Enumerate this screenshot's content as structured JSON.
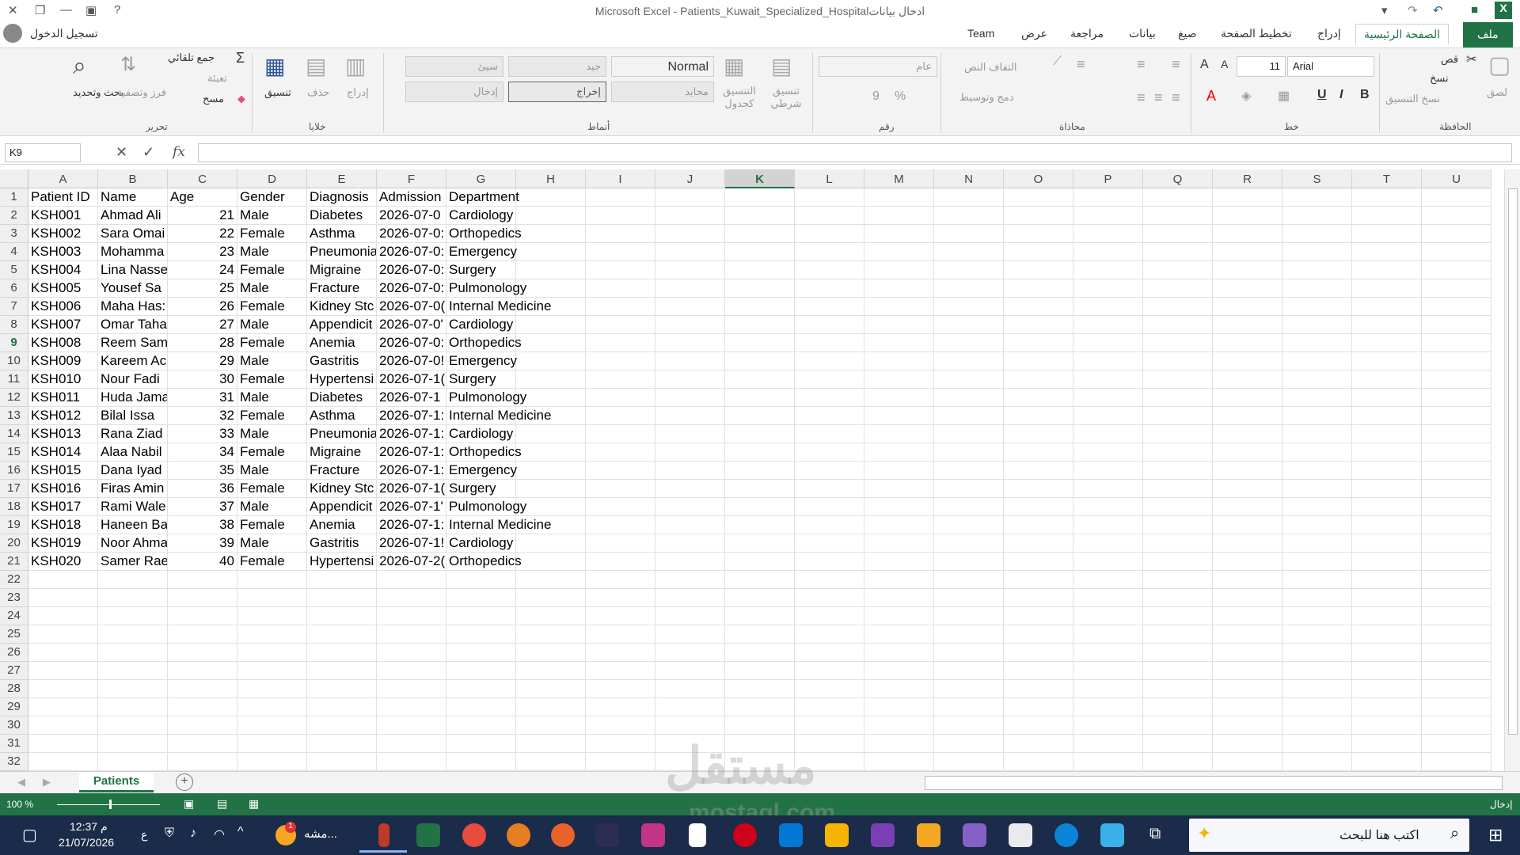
{
  "window": {
    "title": "Microsoft Excel - Patients_Kuwait_Specialized_Hospitalادخال بيانات",
    "signin": "تسجيل الدخول"
  },
  "tabs": {
    "file": "ملف",
    "home": "الصفحة الرئيسية",
    "insert": "إدراج",
    "layout": "تخطيط الصفحة",
    "formulas": "صيغ",
    "data": "بيانات",
    "review": "مراجعة",
    "view": "عرض",
    "team": "Team"
  },
  "ribbon": {
    "clipboard": {
      "label": "الحافظة",
      "paste": "لصق",
      "cut": "قص",
      "copy": "نسخ",
      "format_painter": "نسخ التنسيق"
    },
    "font": {
      "label": "خط",
      "name": "Arial",
      "size": "11",
      "bold": "B",
      "italic": "I",
      "underline": "U"
    },
    "alignment": {
      "label": "محاذاة",
      "wrap": "التفاف النص",
      "merge": "دمج وتوسيط"
    },
    "number": {
      "label": "رقم",
      "format": "عام",
      "percent": "%",
      "comma": "9"
    },
    "styles": {
      "label": "أنماط",
      "conditional": "تنسيق شرطي",
      "as_table": "التنسيق كجدول",
      "normal": "Normal",
      "bad": "سيئ",
      "good": "جيد",
      "neutral": "محايد",
      "calculation": "إخراج",
      "input": "إدخال"
    },
    "cells": {
      "label": "خلايا",
      "insert": "إدراج",
      "delete": "حذف",
      "format": "تنسيق"
    },
    "editing": {
      "label": "تحرير",
      "autosum": "جمع تلقائي",
      "fill": "تعبئة",
      "clear": "مسح",
      "sort": "فرز وتصفية",
      "find": "بحث وتحديد"
    }
  },
  "formula_bar": {
    "name_box": "K9",
    "fx": "fx",
    "value": ""
  },
  "columns": [
    "A",
    "B",
    "C",
    "D",
    "E",
    "F",
    "G",
    "H",
    "I",
    "J",
    "K",
    "L",
    "M",
    "N",
    "O",
    "P",
    "Q",
    "R",
    "S",
    "T",
    "U"
  ],
  "selected_column": "K",
  "selected_row": 9,
  "rows": [
    "1",
    "2",
    "3",
    "4",
    "5",
    "6",
    "7",
    "8",
    "9",
    "10",
    "11",
    "12",
    "13",
    "14",
    "15",
    "16",
    "17",
    "18",
    "19",
    "20",
    "21",
    "22",
    "23",
    "24",
    "25",
    "26",
    "27",
    "28",
    "29",
    "30",
    "31",
    "32"
  ],
  "table": {
    "headers": [
      "Patient ID",
      "Name",
      "Age",
      "Gender",
      "Diagnosis",
      "Admission",
      "Department"
    ],
    "rows": [
      [
        "KSH001",
        "Ahmad Ali",
        "21",
        "Male",
        "Diabetes",
        "2026-07-0",
        "Cardiology"
      ],
      [
        "KSH002",
        "Sara Omai",
        "22",
        "Female",
        "Asthma",
        "2026-07-0:",
        "Orthopedics"
      ],
      [
        "KSH003",
        "Mohamma",
        "23",
        "Male",
        "Pneumonia",
        "2026-07-0:",
        "Emergency"
      ],
      [
        "KSH004",
        "Lina Nasse",
        "24",
        "Female",
        "Migraine",
        "2026-07-0:",
        "Surgery"
      ],
      [
        "KSH005",
        "Yousef Sa",
        "25",
        "Male",
        "Fracture",
        "2026-07-0:",
        "Pulmonology"
      ],
      [
        "KSH006",
        "Maha Has:",
        "26",
        "Female",
        "Kidney Stc",
        "2026-07-0(",
        "Internal Medicine"
      ],
      [
        "KSH007",
        "Omar Taha",
        "27",
        "Male",
        "Appendicit",
        "2026-07-0'",
        "Cardiology"
      ],
      [
        "KSH008",
        "Reem Sam",
        "28",
        "Female",
        "Anemia",
        "2026-07-0:",
        "Orthopedics"
      ],
      [
        "KSH009",
        "Kareem Ac",
        "29",
        "Male",
        "Gastritis",
        "2026-07-0!",
        "Emergency"
      ],
      [
        "KSH010",
        "Nour Fadi",
        "30",
        "Female",
        "Hypertensi",
        "2026-07-1(",
        "Surgery"
      ],
      [
        "KSH011",
        "Huda Jama",
        "31",
        "Male",
        "Diabetes",
        "2026-07-1",
        "Pulmonology"
      ],
      [
        "KSH012",
        "Bilal Issa",
        "32",
        "Female",
        "Asthma",
        "2026-07-1:",
        "Internal Medicine"
      ],
      [
        "KSH013",
        "Rana Ziad",
        "33",
        "Male",
        "Pneumonia",
        "2026-07-1:",
        "Cardiology"
      ],
      [
        "KSH014",
        "Alaa Nabil",
        "34",
        "Female",
        "Migraine",
        "2026-07-1:",
        "Orthopedics"
      ],
      [
        "KSH015",
        "Dana Iyad",
        "35",
        "Male",
        "Fracture",
        "2026-07-1:",
        "Emergency"
      ],
      [
        "KSH016",
        "Firas Amin",
        "36",
        "Female",
        "Kidney Stc",
        "2026-07-1(",
        "Surgery"
      ],
      [
        "KSH017",
        "Rami Wale",
        "37",
        "Male",
        "Appendicit",
        "2026-07-1'",
        "Pulmonology"
      ],
      [
        "KSH018",
        "Haneen Ba",
        "38",
        "Female",
        "Anemia",
        "2026-07-1:",
        "Internal Medicine"
      ],
      [
        "KSH019",
        "Noor Ahma",
        "39",
        "Male",
        "Gastritis",
        "2026-07-1!",
        "Cardiology"
      ],
      [
        "KSH020",
        "Samer Rae",
        "40",
        "Female",
        "Hypertensi",
        "2026-07-2(",
        "Orthopedics"
      ]
    ]
  },
  "sheet_tabs": [
    "Patients"
  ],
  "status": {
    "mode": "إدخال",
    "zoom": "100 %"
  },
  "taskbar": {
    "search_placeholder": "اكتب هنا للبحث",
    "time": "12:37 م",
    "date": "21/07/2026",
    "lang": "ع",
    "running_app": "مشه...",
    "badge": "1"
  },
  "watermark": {
    "arabic": "مستقل",
    "latin": "mostaql.com"
  },
  "colors": {
    "excel_green": "#217346",
    "taskbar": "#1b2b4a"
  }
}
